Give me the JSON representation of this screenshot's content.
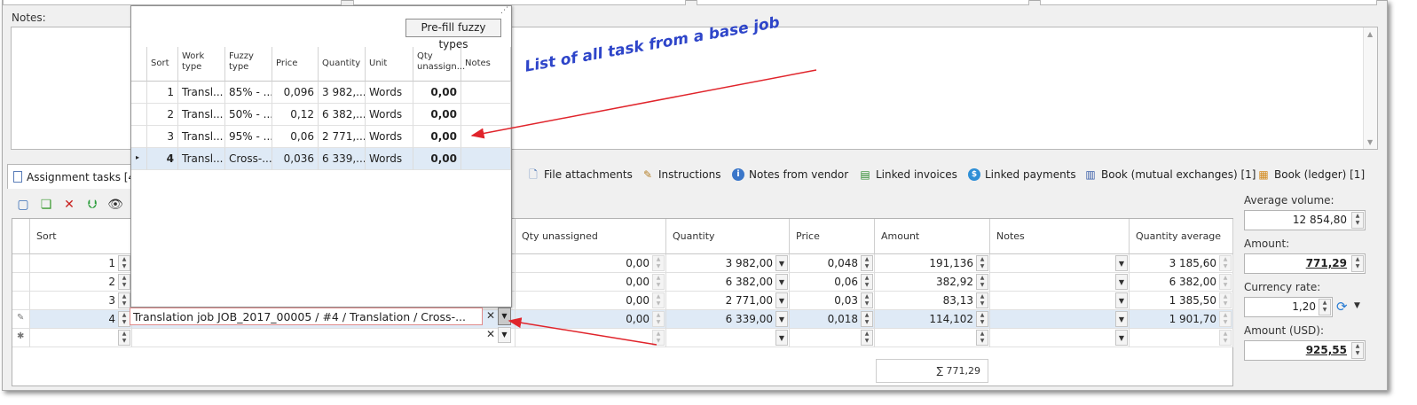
{
  "notes_label": "Notes:",
  "tabs": [
    {
      "label": "Assignment tasks [4]",
      "icon": "document-icon"
    },
    {
      "label": "File attachments",
      "icon": "paperclip-file-icon"
    },
    {
      "label": "Instructions",
      "icon": "instructions-icon"
    },
    {
      "label": "Notes from vendor",
      "icon": "info-icon"
    },
    {
      "label": "Linked invoices",
      "icon": "invoice-icon"
    },
    {
      "label": "Linked payments",
      "icon": "payment-icon"
    },
    {
      "label": "Book (mutual exchanges) [1]",
      "icon": "book-icon"
    },
    {
      "label": "Book (ledger) [1]",
      "icon": "ledger-icon"
    }
  ],
  "toolbar": {
    "icons": [
      "new-icon",
      "copy-icon",
      "delete-icon",
      "import-icon",
      "view-icon"
    ]
  },
  "grid": {
    "columns": [
      "Sort",
      "Qty unassigned",
      "Quantity",
      "Price",
      "Amount",
      "Notes",
      "Quantity average"
    ],
    "rows": [
      {
        "sort": "1",
        "qty_unassigned": "0,00",
        "quantity": "3 982,00",
        "price": "0,048",
        "amount": "191,136",
        "notes": "",
        "quantity_average": "3 185,60"
      },
      {
        "sort": "2",
        "qty_unassigned": "0,00",
        "quantity": "6 382,00",
        "price": "0,06",
        "amount": "382,92",
        "notes": "",
        "quantity_average": "6 382,00"
      },
      {
        "sort": "3",
        "qty_unassigned": "0,00",
        "quantity": "2 771,00",
        "price": "0,03",
        "amount": "83,13",
        "notes": "",
        "quantity_average": "1 385,50"
      },
      {
        "sort": "4",
        "qty_unassigned": "0,00",
        "quantity": "6 339,00",
        "price": "0,018",
        "amount": "114,102",
        "notes": "",
        "quantity_average": "1 901,70"
      }
    ],
    "edit_value": "Translation job JOB_2017_00005 / #4 / Translation / Cross-...",
    "footer_sum": "∑ 771,29"
  },
  "side": {
    "average_volume_label": "Average volume:",
    "average_volume": "12 854,80",
    "amount_label": "Amount:",
    "amount": "771,29",
    "currency_rate_label": "Currency rate:",
    "currency_rate": "1,20",
    "amount_usd_label": "Amount (USD):",
    "amount_usd": "925,55"
  },
  "popup": {
    "prefill_button": "Pre-fill fuzzy types",
    "columns": [
      "Sort",
      "Work type",
      "Fuzzy type",
      "Price",
      "Quantity",
      "Unit",
      "Qty unassign...",
      "Notes"
    ],
    "rows": [
      {
        "sort": "1",
        "work_type": "Transl...",
        "fuzzy_type": "85% - ...",
        "price": "0,096",
        "quantity": "3 982,...",
        "unit": "Words",
        "qty_unassigned": "0,00",
        "notes": ""
      },
      {
        "sort": "2",
        "work_type": "Transl...",
        "fuzzy_type": "50% - ...",
        "price": "0,12",
        "quantity": "6 382,...",
        "unit": "Words",
        "qty_unassigned": "0,00",
        "notes": ""
      },
      {
        "sort": "3",
        "work_type": "Transl...",
        "fuzzy_type": "95% - ...",
        "price": "0,06",
        "quantity": "2 771,...",
        "unit": "Words",
        "qty_unassigned": "0,00",
        "notes": ""
      },
      {
        "sort": "4",
        "work_type": "Transl...",
        "fuzzy_type": "Cross-...",
        "price": "0,036",
        "quantity": "6 339,...",
        "unit": "Words",
        "qty_unassigned": "0,00",
        "notes": ""
      }
    ],
    "selected_row": 4
  },
  "annotation": "List of all task from a base job",
  "colors": {
    "annotation": "#2e45c9",
    "arrow": "#e0242b",
    "selection": "#dfeaf6"
  }
}
